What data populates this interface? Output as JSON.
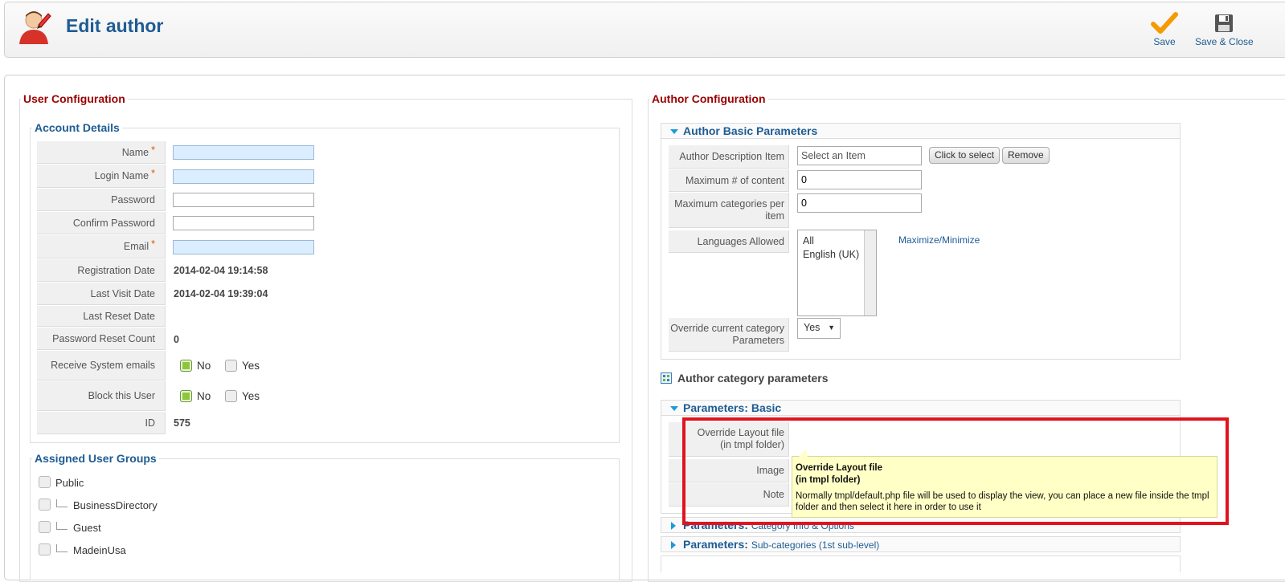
{
  "header": {
    "title": "Edit author",
    "save_label": "Save",
    "save_close_label": "Save & Close"
  },
  "user_config": {
    "title": "User Configuration",
    "account": {
      "title": "Account Details",
      "name_label": "Name",
      "login_label": "Login Name",
      "password_label": "Password",
      "confirm_label": "Confirm Password",
      "email_label": "Email",
      "required_mark": "*",
      "reg_date_label": "Registration Date",
      "reg_date_value": "2014-02-04 19:14:58",
      "last_visit_label": "Last Visit Date",
      "last_visit_value": "2014-02-04 19:39:04",
      "last_reset_label": "Last Reset Date",
      "reset_count_label": "Password Reset Count",
      "reset_count_value": "0",
      "receive_label": "Receive System emails",
      "block_label": "Block this User",
      "no_label": "No",
      "yes_label": "Yes",
      "id_label": "ID",
      "id_value": "575"
    },
    "groups": {
      "title": "Assigned User Groups",
      "items": [
        "Public",
        "BusinessDirectory",
        "Guest",
        "MadeinUsa"
      ]
    }
  },
  "author_config": {
    "title": "Author Configuration",
    "basic": {
      "title": "Author Basic Parameters",
      "desc_label": "Author Description Item",
      "desc_value": "Select an Item",
      "click_select": "Click to select",
      "remove": "Remove",
      "max_content_label": "Maximum # of content",
      "max_content_value": "0",
      "max_cat_label": "Maximum categories per item",
      "max_cat_value": "0",
      "languages_label": "Languages Allowed",
      "languages": [
        "All",
        "English (UK)"
      ],
      "maximize": "Maximize/Minimize",
      "override_label": "Override current category Parameters",
      "override_value": "Yes"
    },
    "cat_params_title": "Author category parameters",
    "params_basic": {
      "title": "Parameters: Basic",
      "layout_label_1": "Override Layout file",
      "layout_label_2": "(in tmpl folder)",
      "image_label": "Image",
      "note_label": "Note"
    },
    "tooltip": {
      "title_1": "Override Layout file",
      "title_2": "(in tmpl folder)",
      "text": "Normally tmpl/default.php file will be used to display the view, you can place a new file inside the tmpl folder and then select it here in order to use it"
    },
    "params_cat": {
      "prefix": "Parameters:",
      "sub": "Category Info & Options"
    },
    "params_sub": {
      "prefix": "Parameters:",
      "sub": "Sub-categories (1st sub-level)"
    }
  },
  "colors": {
    "accent": "#1e5c93",
    "section": "#990000",
    "highlight": "#e0141e"
  }
}
